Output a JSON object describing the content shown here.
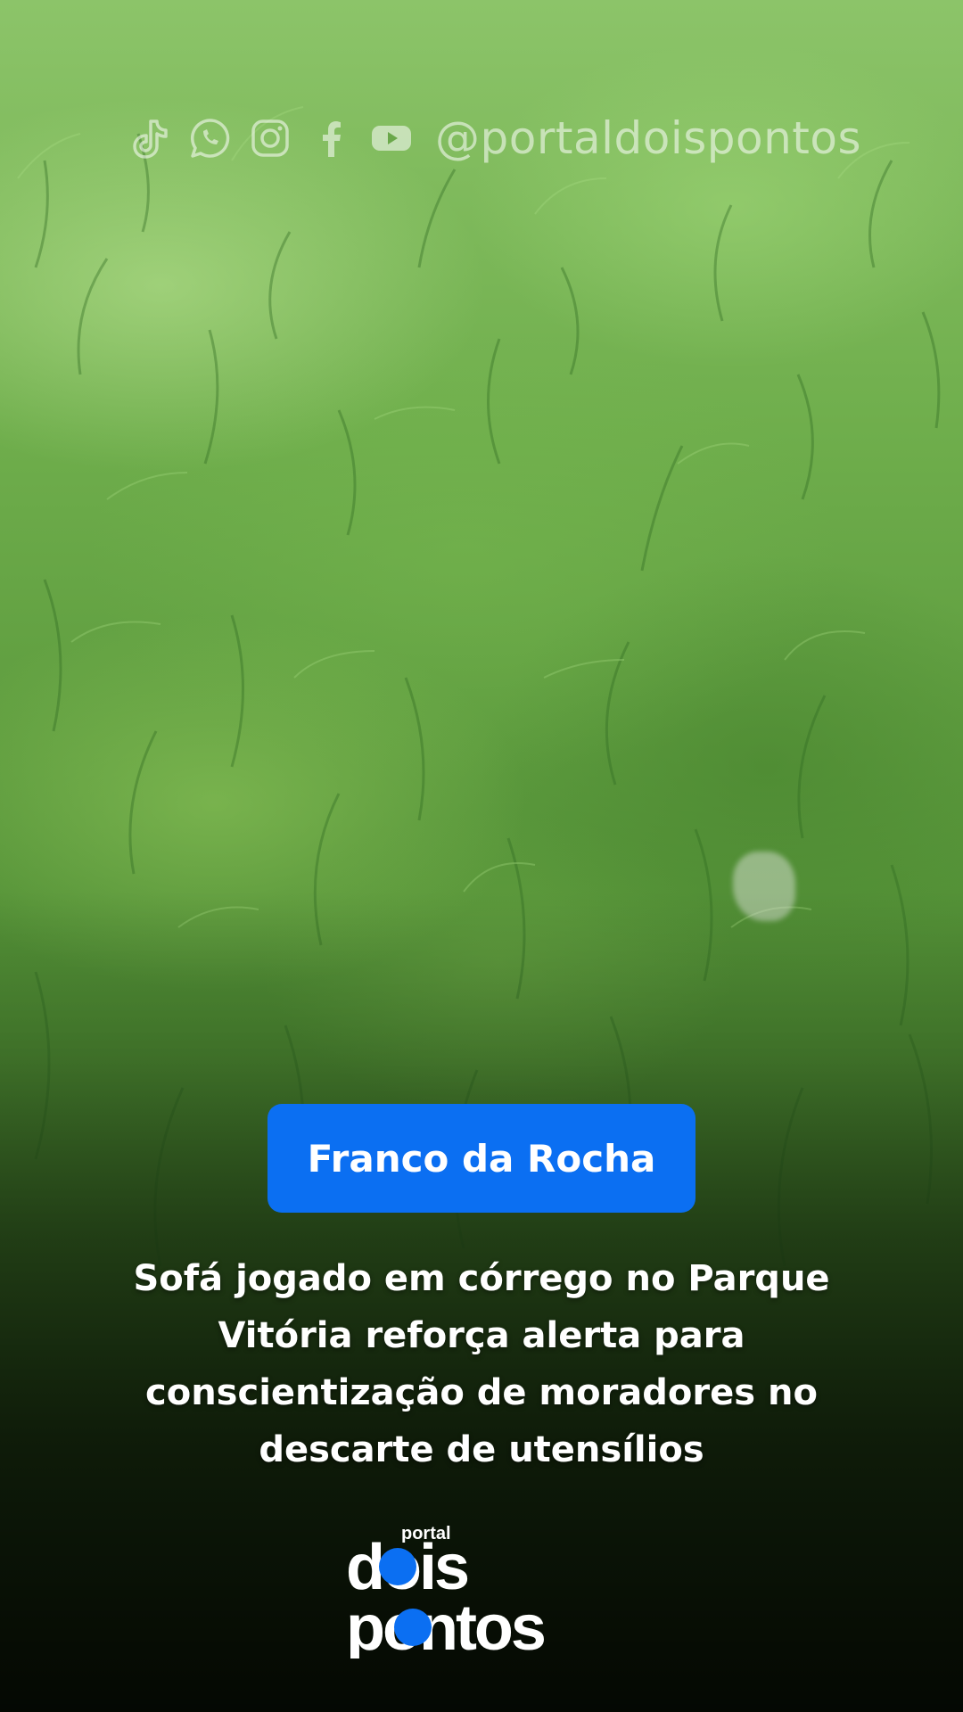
{
  "watermark": {
    "icons": [
      "tiktok-icon",
      "whatsapp-icon",
      "instagram-icon",
      "facebook-icon",
      "youtube-icon"
    ],
    "handle": "@portaldoispontos"
  },
  "badge": {
    "label": "Franco da Rocha",
    "color": "#0b6ff2"
  },
  "headline": {
    "lines": [
      "Sofá jogado em córrego no Parque",
      "Vitória reforça alerta para",
      "conscientização de moradores no",
      "descarte de utensílios"
    ]
  },
  "logo": {
    "small_word": "portal",
    "word_top": "dois",
    "word_bottom": "pontos",
    "accent_color": "#0b6ff2"
  }
}
